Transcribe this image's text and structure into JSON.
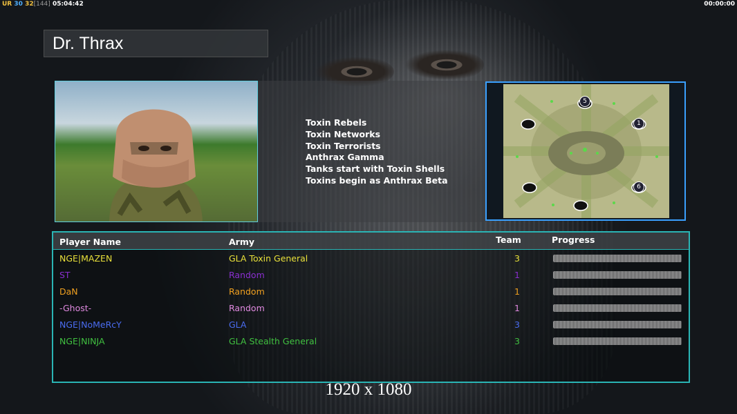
{
  "hud": {
    "left": {
      "a": "UR",
      "b": "30",
      "c": "32",
      "d": "[144]",
      "e": "05:04:42"
    },
    "right": "00:00:00"
  },
  "general": {
    "name": "Dr. Thrax",
    "features": [
      "Toxin Rebels",
      "Toxin Networks",
      "Toxin Terrorists",
      "Anthrax Gamma",
      "Tanks start with Toxin Shells",
      "Toxins begin as Anthrax Beta"
    ]
  },
  "map": {
    "start_positions": [
      "5",
      "1",
      "6"
    ]
  },
  "players": {
    "columns": {
      "name": "Player Name",
      "army": "Army",
      "team": "Team",
      "progress": "Progress"
    },
    "rows": [
      {
        "name": "NGE|MAZEN",
        "army": "GLA Toxin General",
        "team": "3",
        "color": "#e8e03a",
        "progress": 1.0
      },
      {
        "name": "ST",
        "army": "Random",
        "team": "1",
        "color": "#8a2fd0",
        "progress": 1.0
      },
      {
        "name": "DaN",
        "army": "Random",
        "team": "1",
        "color": "#f0a020",
        "progress": 1.0
      },
      {
        "name": "-Ghost-",
        "army": "Random",
        "team": "1",
        "color": "#e08ae0",
        "progress": 1.0
      },
      {
        "name": "NGE|NoMeRcY",
        "army": "GLA",
        "team": "3",
        "color": "#4a6cf0",
        "progress": 1.0
      },
      {
        "name": "NGE|NINJA",
        "army": "GLA Stealth General",
        "team": "3",
        "color": "#40c040",
        "progress": 1.0
      }
    ]
  },
  "resolution": "1920 x 1080"
}
